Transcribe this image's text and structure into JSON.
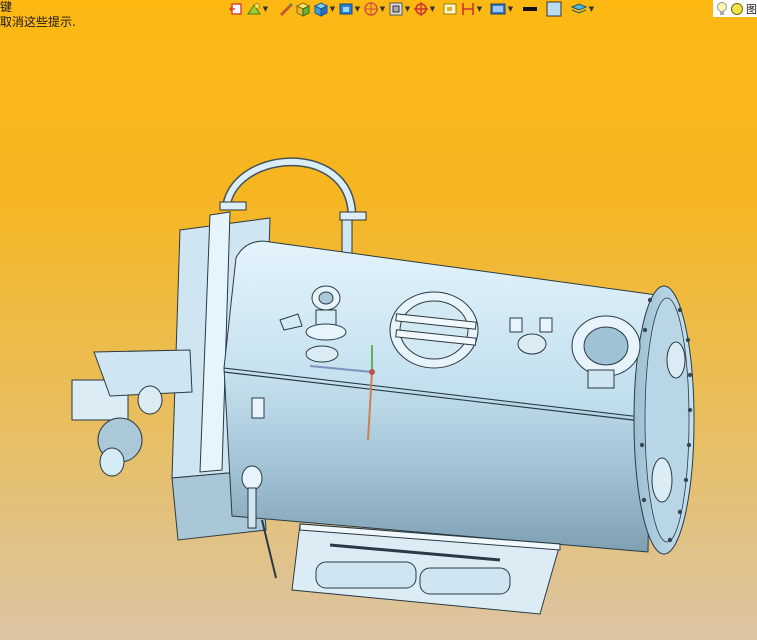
{
  "hint": {
    "line1": "键",
    "line2": "取消这些提示."
  },
  "toolbar": {
    "items": [
      {
        "icon": "previous-view-icon",
        "dropdown": false
      },
      {
        "icon": "display-style-icon",
        "dropdown": true
      },
      {
        "icon": "edit-appearance-icon",
        "dropdown": false
      },
      {
        "icon": "apply-scene-icon",
        "dropdown": true
      },
      {
        "icon": "view-orientation-icon",
        "dropdown": true
      },
      {
        "icon": "display-pane-icon",
        "dropdown": true
      },
      {
        "icon": "hide-show-items-icon",
        "dropdown": true
      },
      {
        "icon": "section-view-icon",
        "dropdown": true
      },
      {
        "icon": "view-settings-icon",
        "dropdown": true
      },
      {
        "icon": "zoom-to-fit-icon",
        "dropdown": false
      },
      {
        "icon": "standard-views-icon",
        "dropdown": true
      },
      {
        "icon": "render-tools-icon",
        "dropdown": true
      },
      {
        "icon": "line-style-icon",
        "dropdown": false
      },
      {
        "icon": "color-swatch-icon",
        "dropdown": false
      },
      {
        "icon": "layers-icon",
        "dropdown": true
      }
    ],
    "tail_text": "图"
  }
}
